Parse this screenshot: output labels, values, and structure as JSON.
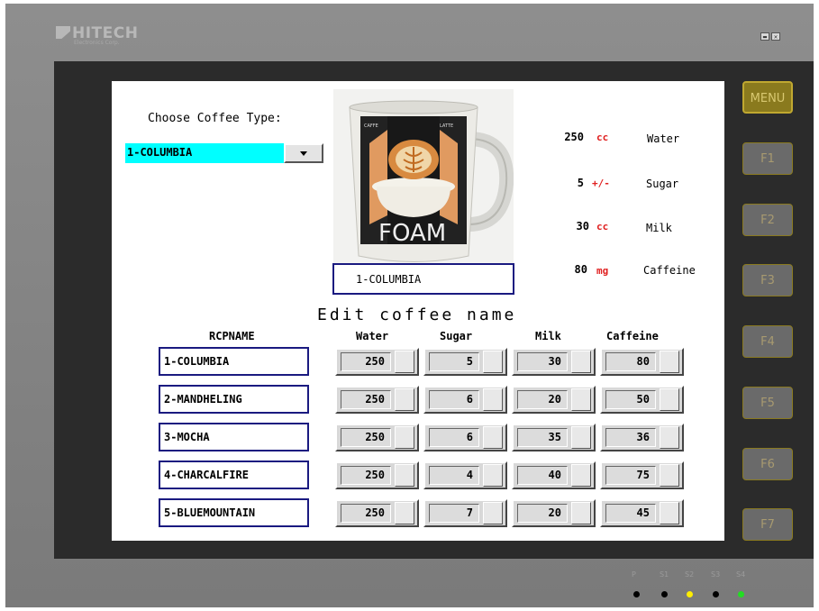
{
  "device": {
    "brand": "HITECH",
    "brand_sub": "Electronics Corp.",
    "window_controls": [
      "minimize-icon",
      "close-icon"
    ],
    "led_labels": [
      "P",
      "S1",
      "S2",
      "S3",
      "S4"
    ],
    "led_colors": [
      "#000000",
      "#000000",
      "#ffee00",
      "#000000",
      "#22dd22"
    ]
  },
  "function_keys": [
    "MENU",
    "F1",
    "F2",
    "F3",
    "F4",
    "F5",
    "F6",
    "F7"
  ],
  "selector": {
    "label": "Choose Coffee Type:",
    "value": "1-COLUMBIA"
  },
  "preview": {
    "image": "coffee-mug-foam",
    "name": "1-COLUMBIA",
    "mug_text": "FOAM"
  },
  "specs": [
    {
      "value": "250",
      "unit": "cc",
      "name": "Water"
    },
    {
      "value": "5",
      "unit": "+/-",
      "name": "Sugar"
    },
    {
      "value": "30",
      "unit": "cc",
      "name": "Milk"
    },
    {
      "value": "80",
      "unit": "mg",
      "name": "Caffeine"
    }
  ],
  "editor": {
    "title": "Edit coffee name",
    "headers": {
      "name": "RCPNAME",
      "water": "Water",
      "sugar": "Sugar",
      "milk": "Milk",
      "caffeine": "Caffeine"
    },
    "rows": [
      {
        "name": "1-COLUMBIA",
        "water": "250",
        "sugar": "5",
        "milk": "30",
        "caffeine": "80"
      },
      {
        "name": "2-MANDHELING",
        "water": "250",
        "sugar": "6",
        "milk": "20",
        "caffeine": "50"
      },
      {
        "name": "3-MOCHA",
        "water": "250",
        "sugar": "6",
        "milk": "35",
        "caffeine": "36"
      },
      {
        "name": "4-CHARCALFIRE",
        "water": "250",
        "sugar": "4",
        "milk": "40",
        "caffeine": "75"
      },
      {
        "name": "5-BLUEMOUNTAIN",
        "water": "250",
        "sugar": "7",
        "milk": "20",
        "caffeine": "45"
      }
    ]
  }
}
